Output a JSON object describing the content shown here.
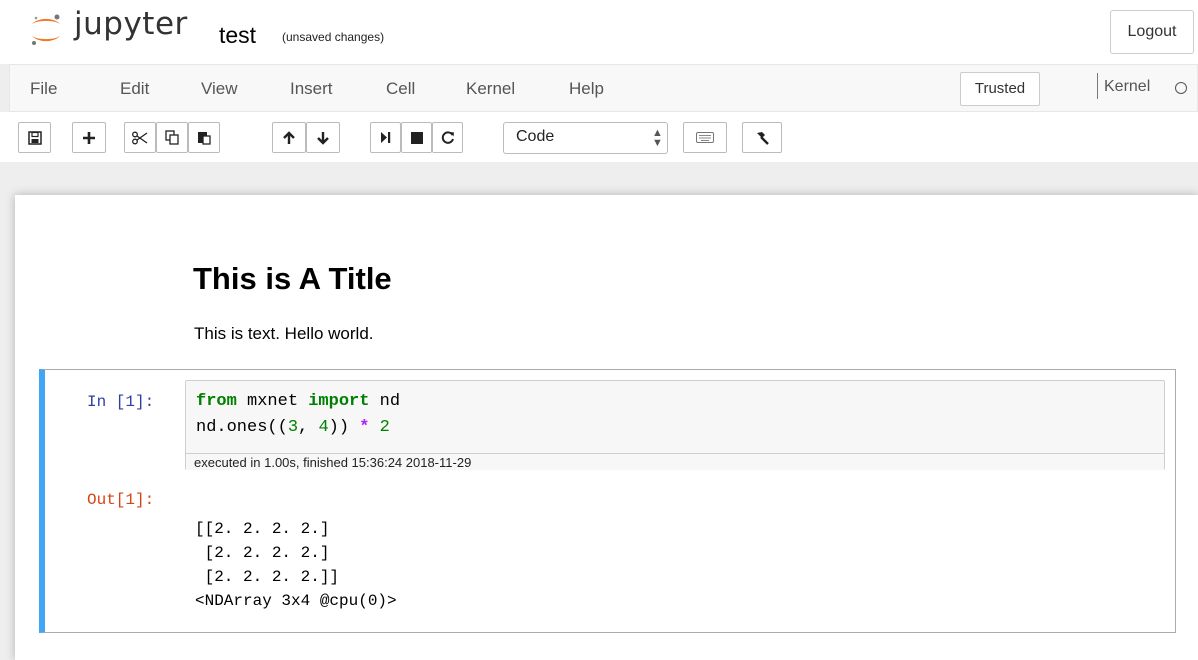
{
  "header": {
    "brand": "jupyter",
    "notebook_name": "test",
    "autosave_status": "(unsaved changes)",
    "logout_label": "Logout"
  },
  "menubar": {
    "items": [
      "File",
      "Edit",
      "View",
      "Insert",
      "Cell",
      "Kernel",
      "Help"
    ],
    "trusted_label": "Trusted",
    "kernel_name": "Kernel"
  },
  "toolbar": {
    "buttons": [
      "save-icon",
      "plus-icon",
      "scissors-icon",
      "copy-icon",
      "paste-icon",
      "arrow-up-icon",
      "arrow-down-icon",
      "run-icon",
      "stop-icon",
      "restart-icon",
      "keyboard-icon",
      "hammer-icon"
    ],
    "cell_type": "Code"
  },
  "markdown": {
    "title": "This is A Title",
    "text": "This is text. Hello world."
  },
  "code_cell": {
    "in_prompt": "In [1]:",
    "code_line_1": {
      "kw1": "from",
      "mod": " mxnet ",
      "kw2": "import",
      "name": " nd"
    },
    "code_line_2": {
      "a": "nd.ones((",
      "n1": "3",
      "b": ", ",
      "n2": "4",
      "c": ")) ",
      "op": "*",
      "d": " ",
      "n3": "2"
    },
    "exec_info": "executed in 1.00s, finished 15:36:24 2018-11-29",
    "out_prompt": "Out[1]:",
    "output_lines": [
      "[[2. 2. 2. 2.]",
      " [2. 2. 2. 2.]",
      " [2. 2. 2. 2.]]",
      "<NDArray 3x4 @cpu(0)>"
    ]
  },
  "colors": {
    "cell_selected_border": "#42a5f5",
    "in_prompt": "#303f9f",
    "out_prompt": "#d84315",
    "logo_orange": "#f37726"
  }
}
